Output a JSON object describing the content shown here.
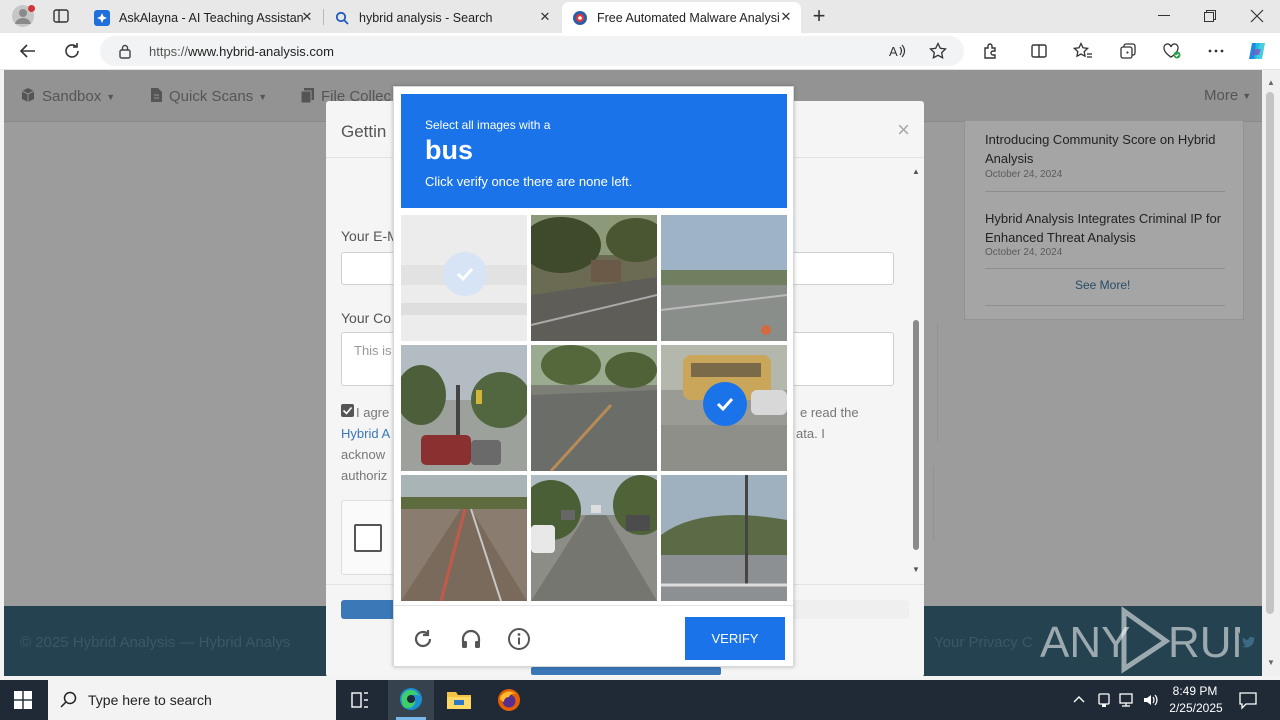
{
  "browser": {
    "tabs": [
      {
        "title": "AskAlayna - AI Teaching Assistan",
        "icon": "puzzle-icon"
      },
      {
        "title": "hybrid analysis - Search",
        "icon": "search-icon"
      },
      {
        "title": "Free Automated Malware Analysi",
        "icon": "hybrid-logo-icon",
        "active": true
      }
    ],
    "close_glyph": "✕",
    "new_tab_glyph": "+",
    "url": "https://www.hybrid-analysis.com",
    "url_display_prefix": "https://",
    "url_display_host": "www.hybrid-analysis.com"
  },
  "site": {
    "nav": [
      {
        "label": "Sandbox",
        "icon": "cube-icon"
      },
      {
        "label": "Quick Scans",
        "icon": "file-icon"
      },
      {
        "label": "File Collec",
        "icon": "files-icon"
      }
    ],
    "nav_more": "More",
    "news": [
      {
        "title": "Introducing Community Score on Hybrid Analysis",
        "date": "October 24, 2024"
      },
      {
        "title": "Hybrid Analysis Integrates Criminal IP for Enhanced Threat Analysis",
        "date": "October 24, 2024"
      }
    ],
    "see_more": "See More!",
    "footer_left": "© 2025 Hybrid Analysis — Hybrid Analys",
    "footer_right": "Your Privacy C"
  },
  "modal": {
    "title": "Gettin",
    "close": "×",
    "email_label": "Your E-M",
    "comment_label": "Your Co",
    "comment_placeholder": "This is",
    "consent_lines": [
      "I agre",
      "Hybrid A",
      "acknow",
      "authoriz"
    ],
    "consent_right_1": "e read the",
    "consent_right_2": "ata. I"
  },
  "captcha": {
    "prompt": "Select all images with a",
    "keyword": "bus",
    "instruction": "Click verify once there are none left.",
    "verify_label": "VERIFY",
    "tiles": [
      {
        "name": "tile-1",
        "selected": true
      },
      {
        "name": "tile-2",
        "selected": false
      },
      {
        "name": "tile-3",
        "selected": false
      },
      {
        "name": "tile-4",
        "selected": false
      },
      {
        "name": "tile-5",
        "selected": false
      },
      {
        "name": "tile-6",
        "selected": true
      },
      {
        "name": "tile-7",
        "selected": false
      },
      {
        "name": "tile-8",
        "selected": false
      },
      {
        "name": "tile-9",
        "selected": false
      }
    ],
    "accent": "#1a73e8"
  },
  "watermark": {
    "text_left": "ANY",
    "text_right": "RUN"
  },
  "taskbar": {
    "search_placeholder": "Type here to search",
    "time": "8:49 PM",
    "date": "2/25/2025"
  }
}
